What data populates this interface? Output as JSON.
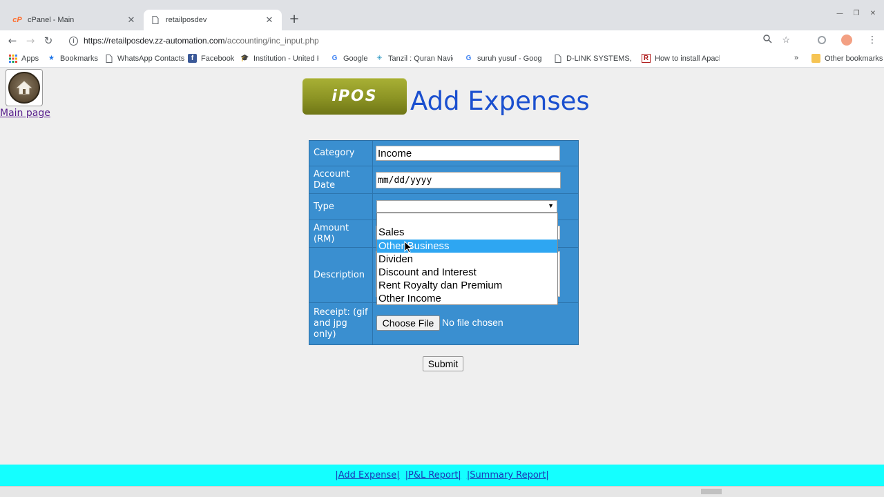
{
  "browser": {
    "tabs": [
      {
        "title": "cPanel - Main",
        "active": false
      },
      {
        "title": "retailposdev",
        "active": true
      }
    ],
    "url_host": "https://retailposdev.zz-automation.com",
    "url_path": "/accounting/inc_input.php",
    "bookmarks": [
      {
        "label": "Apps",
        "icon": "apps-grid-icon"
      },
      {
        "label": "Bookmarks",
        "icon": "star-icon"
      },
      {
        "label": "WhatsApp Contacts",
        "icon": "page-icon"
      },
      {
        "label": "Facebook",
        "icon": "facebook-icon"
      },
      {
        "label": "Institution - United K",
        "icon": "graduation-cap-icon"
      },
      {
        "label": "Google",
        "icon": "google-icon"
      },
      {
        "label": "Tanzil : Quran Naviga",
        "icon": "tanzil-icon"
      },
      {
        "label": "suruh yusuf - Google",
        "icon": "google-icon"
      },
      {
        "label": "D-LINK SYSTEMS, INC",
        "icon": "page-icon"
      },
      {
        "label": "How to install Apache",
        "icon": "redhat-icon"
      }
    ],
    "overflow": "»",
    "other_bookmarks": "Other bookmarks"
  },
  "page": {
    "home_link": "Main page",
    "logo_text": "iPOS",
    "title": "Add Expenses",
    "form": {
      "category_label": "Category",
      "category_value": "Income",
      "date_label": "Account Date",
      "date_placeholder": "mm/dd/yyyy",
      "type_label": "Type",
      "type_value": "",
      "amount_label": "Amount (RM)",
      "description_label": "Description",
      "receipt_label": "Receipt: (gif and jpg only)",
      "choose_file": "Choose File",
      "file_status": "No file chosen"
    },
    "type_options": [
      "",
      "Sales",
      "Other Business",
      "Dividen",
      "Discount and Interest",
      "Rent Royalty dan Premium",
      "Other Income"
    ],
    "highlighted_option_index": 2,
    "submit": "Submit",
    "footer_links": [
      "|Add Expense|",
      "|P&L Report|",
      "|Summary Report|"
    ]
  },
  "colors": {
    "form_bg": "#3a8fd0",
    "title": "#1a4fcf",
    "footer_bg": "#14ffff",
    "option_highlight": "#2ea6f2"
  }
}
